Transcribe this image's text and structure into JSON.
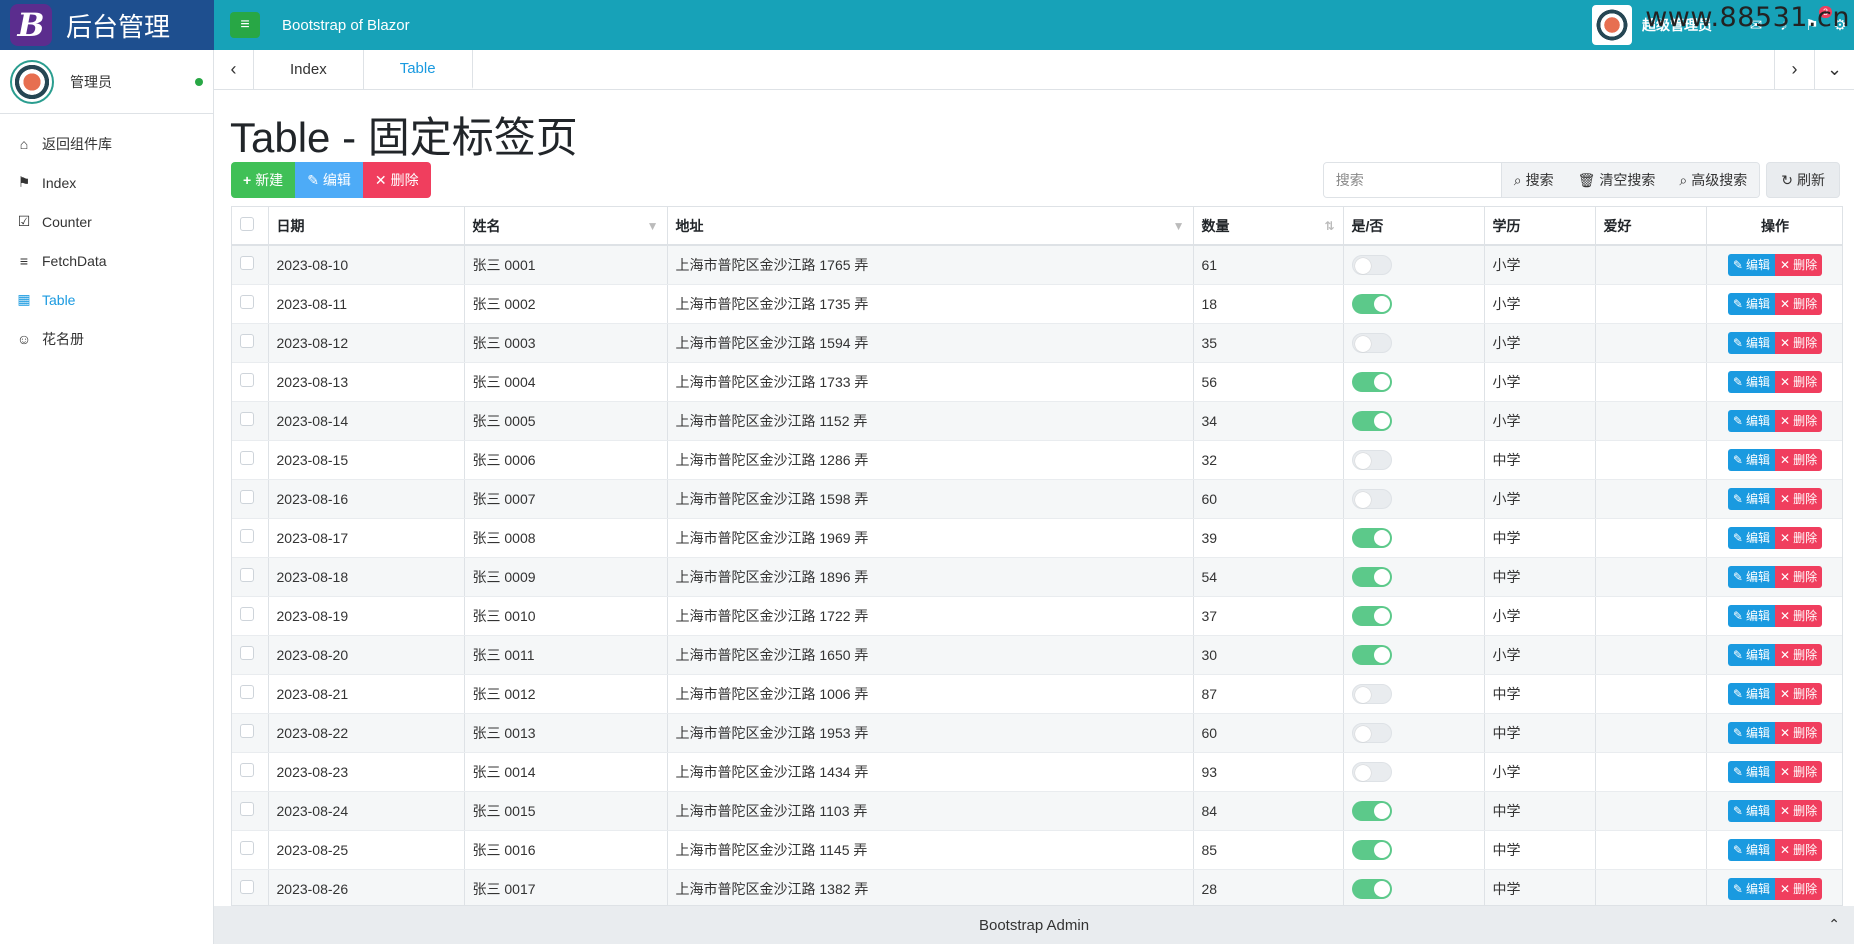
{
  "brand": {
    "logo_letter": "B",
    "title": "后台管理"
  },
  "header": {
    "title": "Bootstrap of Blazor",
    "user": "超级管理员",
    "watermark": "www.88531.cn",
    "badges": [
      "",
      "3"
    ]
  },
  "sidebar": {
    "user_name": "管理员",
    "items": [
      {
        "label": "返回组件库",
        "icon": "home-icon",
        "glyph": "⌂"
      },
      {
        "label": "Index",
        "icon": "flag-icon",
        "glyph": "⚑"
      },
      {
        "label": "Counter",
        "icon": "checkbox-icon",
        "glyph": "☑"
      },
      {
        "label": "FetchData",
        "icon": "database-icon",
        "glyph": "≡"
      },
      {
        "label": "Table",
        "icon": "table-icon",
        "glyph": "▦"
      },
      {
        "label": "花名册",
        "icon": "users-icon",
        "glyph": "☺"
      }
    ],
    "active_index": 4
  },
  "tabs": [
    {
      "label": "Index"
    },
    {
      "label": "Table"
    }
  ],
  "page": {
    "title": "Table - 固定标签页"
  },
  "toolbar": {
    "add": "新建",
    "edit": "编辑",
    "delete": "删除"
  },
  "search": {
    "placeholder": "搜索",
    "search_btn": "搜索",
    "clear_btn": "清空搜索",
    "advanced_btn": "高级搜索",
    "refresh_btn": "刷新"
  },
  "table": {
    "columns": [
      "日期",
      "姓名",
      "地址",
      "数量",
      "是/否",
      "学历",
      "爱好",
      "操作"
    ],
    "edit_label": "编辑",
    "delete_label": "删除",
    "rows": [
      {
        "date": "2023-08-10",
        "name": "张三 0001",
        "address": "上海市普陀区金沙江路 1765 弄",
        "count": "61",
        "flag": false,
        "edu": "小学",
        "hobby": ""
      },
      {
        "date": "2023-08-11",
        "name": "张三 0002",
        "address": "上海市普陀区金沙江路 1735 弄",
        "count": "18",
        "flag": true,
        "edu": "小学",
        "hobby": ""
      },
      {
        "date": "2023-08-12",
        "name": "张三 0003",
        "address": "上海市普陀区金沙江路 1594 弄",
        "count": "35",
        "flag": false,
        "edu": "小学",
        "hobby": ""
      },
      {
        "date": "2023-08-13",
        "name": "张三 0004",
        "address": "上海市普陀区金沙江路 1733 弄",
        "count": "56",
        "flag": true,
        "edu": "小学",
        "hobby": ""
      },
      {
        "date": "2023-08-14",
        "name": "张三 0005",
        "address": "上海市普陀区金沙江路 1152 弄",
        "count": "34",
        "flag": true,
        "edu": "小学",
        "hobby": ""
      },
      {
        "date": "2023-08-15",
        "name": "张三 0006",
        "address": "上海市普陀区金沙江路 1286 弄",
        "count": "32",
        "flag": false,
        "edu": "中学",
        "hobby": ""
      },
      {
        "date": "2023-08-16",
        "name": "张三 0007",
        "address": "上海市普陀区金沙江路 1598 弄",
        "count": "60",
        "flag": false,
        "edu": "小学",
        "hobby": ""
      },
      {
        "date": "2023-08-17",
        "name": "张三 0008",
        "address": "上海市普陀区金沙江路 1969 弄",
        "count": "39",
        "flag": true,
        "edu": "中学",
        "hobby": ""
      },
      {
        "date": "2023-08-18",
        "name": "张三 0009",
        "address": "上海市普陀区金沙江路 1896 弄",
        "count": "54",
        "flag": true,
        "edu": "中学",
        "hobby": ""
      },
      {
        "date": "2023-08-19",
        "name": "张三 0010",
        "address": "上海市普陀区金沙江路 1722 弄",
        "count": "37",
        "flag": true,
        "edu": "小学",
        "hobby": ""
      },
      {
        "date": "2023-08-20",
        "name": "张三 0011",
        "address": "上海市普陀区金沙江路 1650 弄",
        "count": "30",
        "flag": true,
        "edu": "小学",
        "hobby": ""
      },
      {
        "date": "2023-08-21",
        "name": "张三 0012",
        "address": "上海市普陀区金沙江路 1006 弄",
        "count": "87",
        "flag": false,
        "edu": "中学",
        "hobby": ""
      },
      {
        "date": "2023-08-22",
        "name": "张三 0013",
        "address": "上海市普陀区金沙江路 1953 弄",
        "count": "60",
        "flag": false,
        "edu": "中学",
        "hobby": ""
      },
      {
        "date": "2023-08-23",
        "name": "张三 0014",
        "address": "上海市普陀区金沙江路 1434 弄",
        "count": "93",
        "flag": false,
        "edu": "小学",
        "hobby": ""
      },
      {
        "date": "2023-08-24",
        "name": "张三 0015",
        "address": "上海市普陀区金沙江路 1103 弄",
        "count": "84",
        "flag": true,
        "edu": "中学",
        "hobby": ""
      },
      {
        "date": "2023-08-25",
        "name": "张三 0016",
        "address": "上海市普陀区金沙江路 1145 弄",
        "count": "85",
        "flag": true,
        "edu": "中学",
        "hobby": ""
      },
      {
        "date": "2023-08-26",
        "name": "张三 0017",
        "address": "上海市普陀区金沙江路 1382 弄",
        "count": "28",
        "flag": true,
        "edu": "中学",
        "hobby": ""
      }
    ]
  },
  "footer": {
    "text": "Bootstrap Admin"
  },
  "colors": {
    "header": "#17a2b8",
    "brand": "#1e4f8f",
    "accent": "#1a9ae0",
    "success": "#40c057",
    "danger": "#f03e5e"
  }
}
